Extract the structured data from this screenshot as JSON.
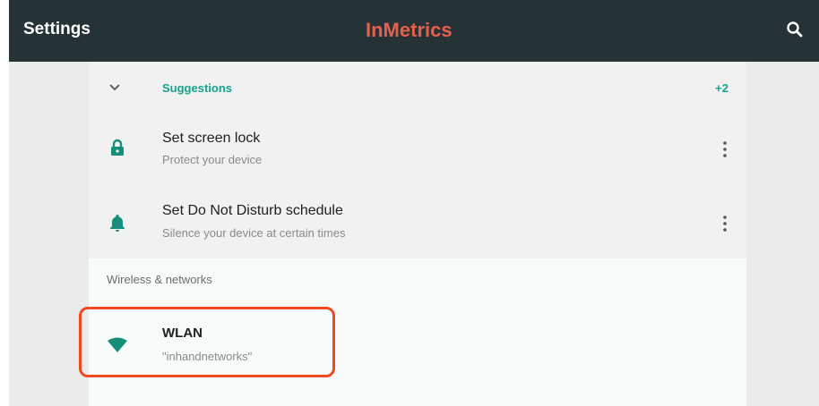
{
  "app_bar": {
    "title": "Settings",
    "brand": "InMetrics",
    "search_icon": "search-icon"
  },
  "suggestions": {
    "label": "Suggestions",
    "count": "+2",
    "items": [
      {
        "title": "Set screen lock",
        "subtitle": "Protect your device",
        "icon": "lock-icon"
      },
      {
        "title": "Set Do Not Disturb schedule",
        "subtitle": "Silence your device at certain times",
        "icon": "bell-icon"
      }
    ]
  },
  "wireless": {
    "section_title": "Wireless & networks",
    "wlan": {
      "title": "WLAN",
      "subtitle": "\"inhandnetworks\"",
      "icon": "wifi-icon"
    }
  },
  "colors": {
    "app_bar": "#253337",
    "brand": "#e8604c",
    "accent": "#15a38d",
    "highlight": "#f04a20"
  }
}
